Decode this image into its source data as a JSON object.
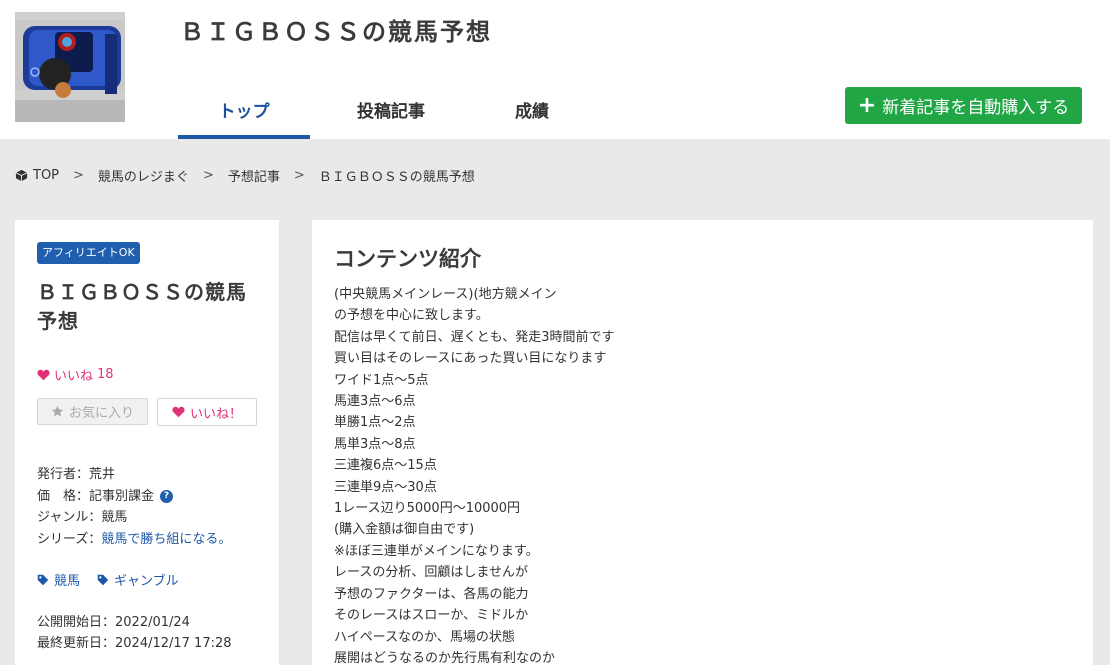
{
  "header": {
    "site_title": "ＢＩＧＢＯＳＳの競馬予想",
    "tabs": [
      "トップ",
      "投稿記事",
      "成績"
    ],
    "auto_buy_label": "新着記事を自動購入する"
  },
  "breadcrumb": [
    "TOP",
    "競馬のレジまぐ",
    "予想記事",
    "ＢＩＧＢＯＳＳの競馬予想"
  ],
  "sidebar": {
    "badge": "アフィリエイトOK",
    "title": "ＢＩＧＢＯＳＳの競馬予想",
    "like_label": "いいね",
    "like_count": "18",
    "favorite_button": "お気に入り",
    "like_button": "いいね！",
    "publisher_label": "発行者：",
    "publisher": "荒井",
    "price_label": "価　格：",
    "price": "記事別課金",
    "genre_label": "ジャンル：",
    "genre": "競馬",
    "series_label": "シリーズ：",
    "series": "競馬で勝ち組になる。",
    "tags": [
      "競馬",
      "ギャンブル"
    ],
    "published": "公開開始日：2022/01/24",
    "updated": "最終更新日：2024/12/17 17:28"
  },
  "content": {
    "heading": "コンテンツ紹介",
    "lines": [
      "(中央競馬メインレース)(地方競メイン",
      "の予想を中心に致します。",
      "配信は早くて前日、遅くとも、発走3時間前です",
      "買い目はそのレースにあった買い目になります",
      "ワイド1点～5点",
      "馬連3点～6点",
      "単勝1点～2点",
      "馬単3点～8点",
      "三連複6点～15点",
      "三連単9点～30点",
      "1レース辺り5000円～10000円",
      "(購入金額は御自由です)",
      "※ほぼ三連単がメインになります。",
      "レースの分析、回顧はしませんが",
      "予想のファクターは、各馬の能力",
      "そのレースはスローか、ミドルか",
      "ハイペースなのか、馬場の状態",
      "展開はどうなるのか先行馬有利なのか"
    ]
  },
  "colors": {
    "accent_blue": "#1d58a8",
    "green_button": "#21a645",
    "like_pink": "#e0317a",
    "page_bg": "#e9e9e9"
  }
}
